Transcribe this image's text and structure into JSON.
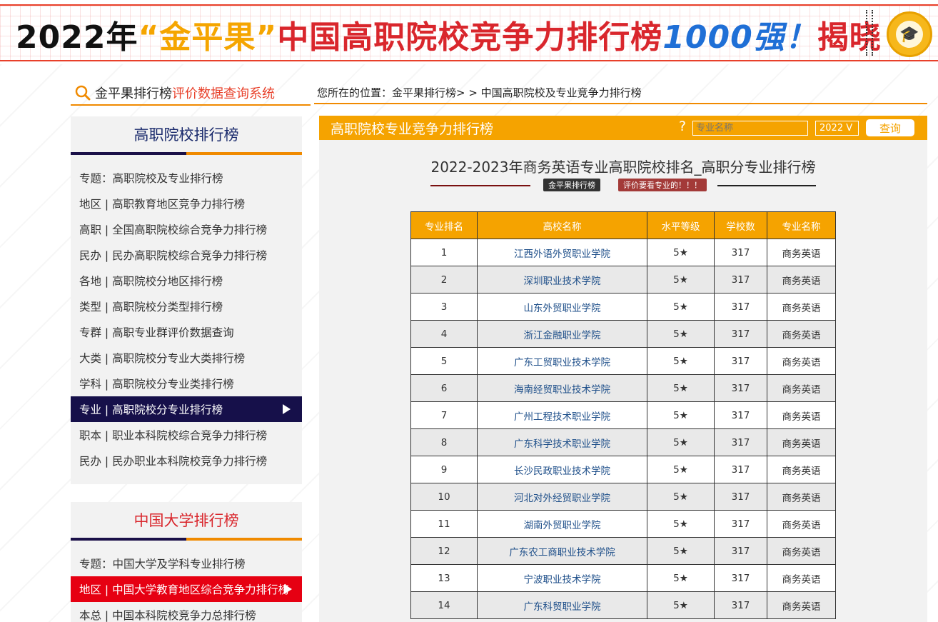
{
  "banner": {
    "year": "2022年",
    "brand": "“金平果”",
    "main": "中国高职院校竞争力排行榜",
    "count": "1000强！",
    "reveal": "揭晓"
  },
  "system": {
    "title_part1": "金平果排行榜",
    "title_part2": "评价数据查询系统"
  },
  "breadcrumb": "您所在的位置：金平果排行榜> > 中国高职院校及专业竞争力排行榜",
  "sidebar1": {
    "heading": "高职院校排行榜",
    "items": [
      "专题：高职院校及专业排行榜",
      "地区 | 高职教育地区竞争力排行榜",
      "高职 | 全国高职院校综合竞争力排行榜",
      "民办 | 民办高职院校综合竞争力排行榜",
      "各地 | 高职院校分地区排行榜",
      "类型 | 高职院校分类型排行榜",
      "专群 | 高职专业群评价数据查询",
      "大类 | 高职院校分专业大类排行榜",
      "学科 | 高职院校分专业类排行榜",
      "专业 | 高职院校分专业排行榜",
      "职本 | 职业本科院校综合竞争力排行榜",
      "民办 | 民办职业本科院校竞争力排行榜"
    ]
  },
  "sidebar2": {
    "heading": "中国大学排行榜",
    "items": [
      "专题：中国大学及学科专业排行榜",
      "地区 | 中国大学教育地区综合竞争力排行榜",
      "本总 | 中国本科院校竞争力总排行榜"
    ]
  },
  "main": {
    "header_title": "高职院校专业竞争力排行榜",
    "help": "?",
    "search_placeholder": "专业名称",
    "year_select": "2022 V",
    "query_button": "查询",
    "rank_title": "2022-2023年商务英语专业高职院校排名_高职分专业排行榜",
    "tag1": "金平果排行榜",
    "tag2": "评价要看专业的！！！"
  },
  "table": {
    "headers": [
      "专业排名",
      "高校名称",
      "水平等级",
      "学校数",
      "专业名称"
    ],
    "rows": [
      [
        "1",
        "江西外语外贸职业学院",
        "5★",
        "317",
        "商务英语"
      ],
      [
        "2",
        "深圳职业技术学院",
        "5★",
        "317",
        "商务英语"
      ],
      [
        "3",
        "山东外贸职业学院",
        "5★",
        "317",
        "商务英语"
      ],
      [
        "4",
        "浙江金融职业学院",
        "5★",
        "317",
        "商务英语"
      ],
      [
        "5",
        "广东工贸职业技术学院",
        "5★",
        "317",
        "商务英语"
      ],
      [
        "6",
        "海南经贸职业技术学院",
        "5★",
        "317",
        "商务英语"
      ],
      [
        "7",
        "广州工程技术职业学院",
        "5★",
        "317",
        "商务英语"
      ],
      [
        "8",
        "广东科学技术职业学院",
        "5★",
        "317",
        "商务英语"
      ],
      [
        "9",
        "长沙民政职业技术学院",
        "5★",
        "317",
        "商务英语"
      ],
      [
        "10",
        "河北对外经贸职业学院",
        "5★",
        "317",
        "商务英语"
      ],
      [
        "11",
        "湖南外贸职业学院",
        "5★",
        "317",
        "商务英语"
      ],
      [
        "12",
        "广东农工商职业技术学院",
        "5★",
        "317",
        "商务英语"
      ],
      [
        "13",
        "宁波职业技术学院",
        "5★",
        "317",
        "商务英语"
      ],
      [
        "14",
        "广东科贸职业学院",
        "5★",
        "317",
        "商务英语"
      ]
    ]
  },
  "colors": {
    "orange": "#f5a300",
    "navy": "#16104a",
    "red": "#e60012",
    "link": "#1d4e89"
  }
}
